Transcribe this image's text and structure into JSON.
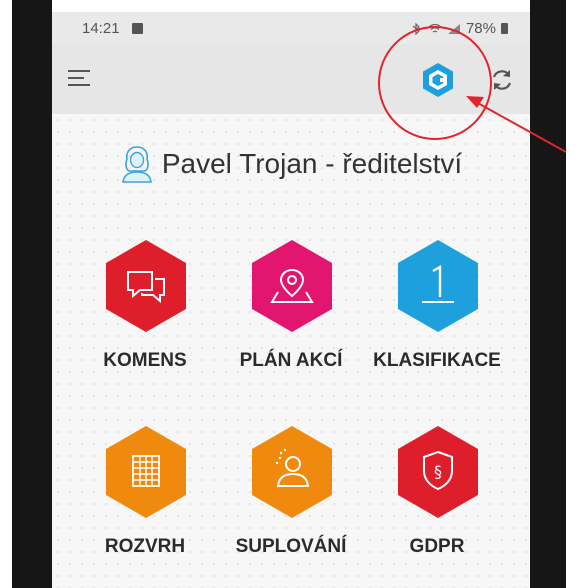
{
  "status_bar": {
    "time": "14:21",
    "battery": "78%"
  },
  "app_bar": {
    "menu_icon": "hamburger-menu-icon",
    "logo_icon": "bakalari-logo-icon",
    "refresh_icon": "refresh-icon"
  },
  "user": {
    "name": "Pavel Trojan - ředitelství",
    "avatar_icon": "user-avatar-icon"
  },
  "tiles": [
    {
      "label": "KOMENS",
      "icon": "chat-bubbles-icon",
      "color": "#de1f2b"
    },
    {
      "label": "PLÁN AKCÍ",
      "icon": "map-pin-icon",
      "color": "#e2166f"
    },
    {
      "label": "KLASIFIKACE",
      "icon": "grade-one-icon",
      "color": "#1ea0dc"
    },
    {
      "label": "ROZVRH",
      "icon": "timetable-icon",
      "color": "#ef8a0e"
    },
    {
      "label": "SUPLOVÁNÍ",
      "icon": "substitute-person-icon",
      "color": "#ef8a0e"
    },
    {
      "label": "GDPR",
      "icon": "gdpr-shield-icon",
      "color": "#de1f2b"
    }
  ],
  "colors": {
    "annotation": "#e0262a",
    "logo": "#1e9fe0"
  }
}
